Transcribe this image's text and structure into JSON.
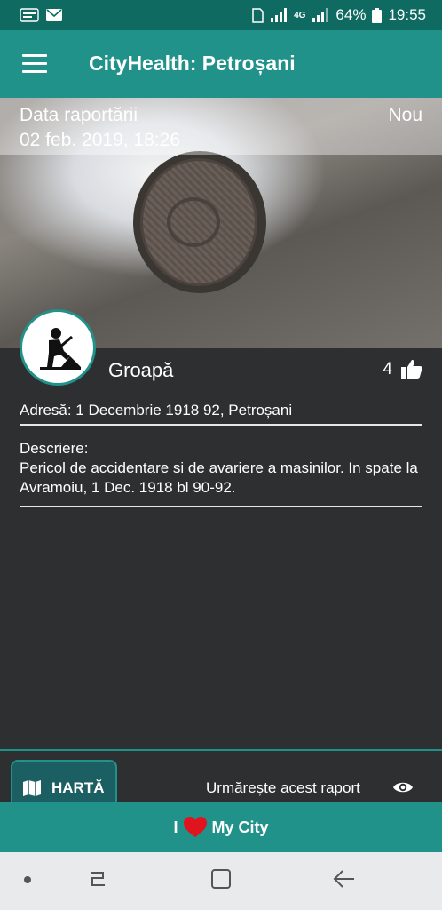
{
  "status_bar": {
    "battery": "64%",
    "time": "19:55",
    "network": "4G"
  },
  "app_bar": {
    "title": "CityHealth: Petroșani"
  },
  "report": {
    "date_label": "Data raportării",
    "date_value": "02 feb. 2019, 18:26",
    "status": "Nou",
    "category": "Groapă",
    "likes": "4",
    "address": "Adresă: 1 Decembrie 1918 92, Petroșani",
    "description_label": "Descriere:",
    "description": "Pericol de accidentare si de avariere a masinilor. In spate la Avramoiu, 1 Dec. 1918 bl 90-92."
  },
  "actions": {
    "map_label": "HARTĂ",
    "follow_label": "Urmărește acest raport"
  },
  "footer": {
    "prefix": "I",
    "suffix": "My City"
  },
  "colors": {
    "primary": "#20928a",
    "status_bar": "#0f6b62",
    "background": "#2e2f31",
    "heart": "#e0141e"
  }
}
